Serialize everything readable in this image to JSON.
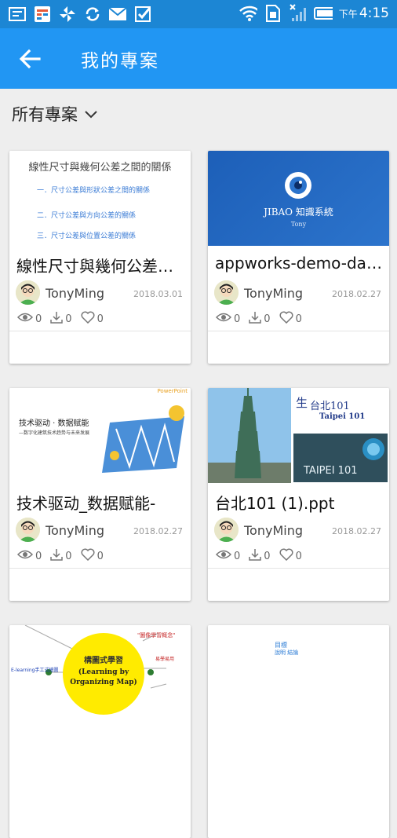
{
  "status_bar": {
    "time_prefix": "下午",
    "time": "4:15",
    "icons": [
      "gallery-icon",
      "calendar-icon",
      "pinwheel-icon",
      "sync-icon",
      "mail-icon",
      "check-icon",
      "wifi-icon",
      "sim-icon",
      "no-signal-icon",
      "battery-icon"
    ]
  },
  "app_bar": {
    "title": "我的專案",
    "back_icon": "back-arrow-icon"
  },
  "filter": {
    "label": "所有專案",
    "icon": "chevron-down-icon"
  },
  "cards": [
    {
      "title": "線性尺寸與幾何公差之間的關係",
      "owner": "TonyMing",
      "date": "2018.03.01",
      "views": "0",
      "downloads": "0",
      "likes": "0",
      "thumb": {
        "heading": "線性尺寸與幾何公差之間的關係",
        "lines": [
          "一．尺寸公差與形狀公差之間的關係",
          "二．尺寸公差與方向公差的關係",
          "三．尺寸公差與位置公差的關係"
        ]
      }
    },
    {
      "title": "appworks-demo-data",
      "owner": "TonyMing",
      "date": "2018.02.27",
      "views": "0",
      "downloads": "0",
      "likes": "0",
      "thumb": {
        "heading": "JIBAO 知識系統",
        "sub": "Tony"
      }
    },
    {
      "title": "技术驱动_数据赋能-",
      "owner": "TonyMing",
      "date": "2018.02.27",
      "views": "0",
      "downloads": "0",
      "likes": "0",
      "thumb": {
        "heading": "技术驱动 · 数据赋能",
        "sub": "—数字化建筑技术趋势与未来发展",
        "corner": "PowerPoint"
      }
    },
    {
      "title": "台北101 (1).ppt",
      "owner": "TonyMing",
      "date": "2018.02.27",
      "views": "0",
      "downloads": "0",
      "likes": "0",
      "thumb": {
        "heading": "台北101",
        "sub": "Taipei 101",
        "sign": "TAIPEI 101",
        "prefix": "生"
      }
    },
    {
      "thumb": {
        "heading": "構圖式學習",
        "sub": "(Learning by Organizing Map)",
        "left_label": "E-learning手工式繪圖",
        "top_label": "\"圖像學習概念\"",
        "right_label": "易學易用"
      }
    },
    {
      "thumb": {
        "heading": "目標",
        "sub": "說明  結論"
      }
    }
  ]
}
